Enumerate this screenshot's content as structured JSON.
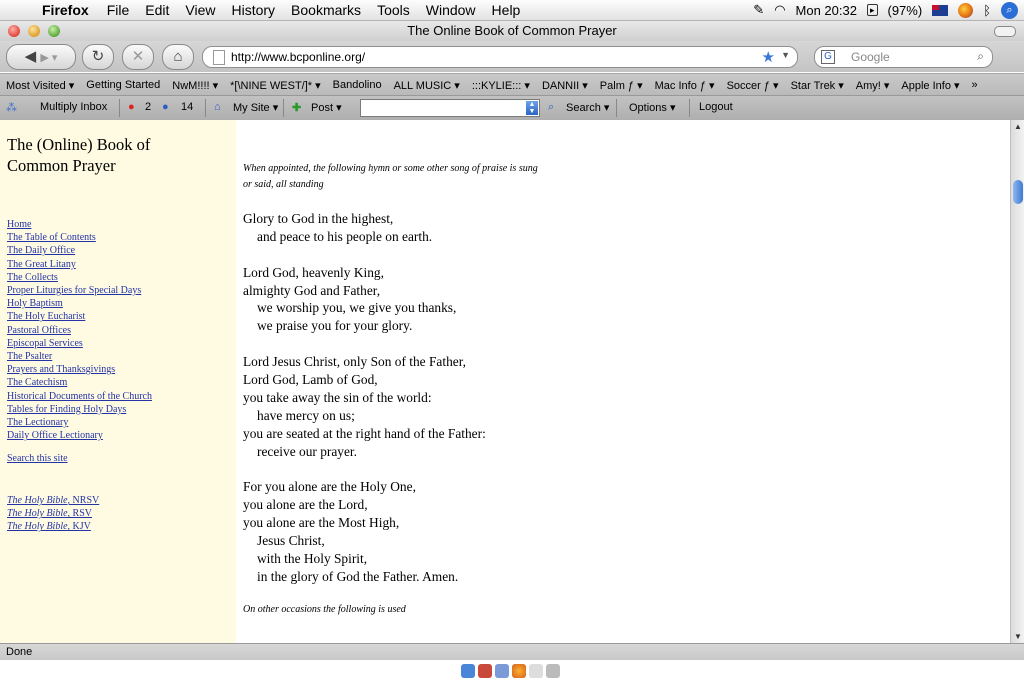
{
  "menubar": {
    "app_name": "Firefox",
    "items": [
      "File",
      "Edit",
      "View",
      "History",
      "Bookmarks",
      "Tools",
      "Window",
      "Help"
    ],
    "clock": "Mon 20:32",
    "battery": "(97%)"
  },
  "window": {
    "title": "The Online Book of Common Prayer"
  },
  "navbar": {
    "url": "http://www.bcponline.org/",
    "search_placeholder": "Google"
  },
  "bookmarks": [
    "Most Visited ▾",
    "Getting Started",
    "NwM!!!! ▾",
    "*[\\NINE WEST/]* ▾",
    "Bandolino",
    "ALL MUSIC ▾",
    ":::KYLIE::: ▾",
    "DANNII ▾",
    "Palm ƒ ▾",
    "Mac Info ƒ ▾",
    "Soccer ƒ ▾",
    "Star Trek ▾",
    "Amy! ▾",
    "Apple Info ▾",
    "»"
  ],
  "extbar": {
    "multiply": "Multiply Inbox",
    "messages": "2",
    "contacts": "14",
    "mysite": "My Site ▾",
    "post": "Post ▾",
    "search": "Search ▾",
    "options": "Options ▾",
    "logout": "Logout"
  },
  "sidebar": {
    "title": "The (Online) Book of Common Prayer",
    "links": [
      "Home",
      "The Table of Contents",
      "The Daily Office",
      "The Great Litany",
      "The Collects",
      "Proper Liturgies for Special Days",
      "Holy Baptism",
      "The Holy Eucharist",
      "Pastoral Offices",
      "Episcopal Services",
      "The Psalter",
      "Prayers and Thanksgivings",
      "The Catechism",
      "Historical Documents of the Church",
      "Tables for Finding Holy Days",
      "The Lectionary",
      "Daily Office Lectionary"
    ],
    "search_link": "Search this site",
    "bibles": [
      {
        "name": "The Holy Bible",
        "version": ", NRSV"
      },
      {
        "name": "The Holy Bible",
        "version": ", RSV"
      },
      {
        "name": "The Holy Bible",
        "version": ", KJV"
      }
    ]
  },
  "content": {
    "rubric_1": "When appointed, the following hymn or some other song of praise is sung or said, all standing",
    "hymn_lines": [
      {
        "t": "Glory to God in the highest,",
        "ind": false
      },
      {
        "t": "and peace to his people on earth.",
        "ind": true
      },
      {
        "t": "",
        "ind": false
      },
      {
        "t": "Lord God, heavenly King,",
        "ind": false
      },
      {
        "t": "almighty God and Father,",
        "ind": false
      },
      {
        "t": "we worship you, we give you thanks,",
        "ind": true
      },
      {
        "t": "we praise you for your glory.",
        "ind": true
      },
      {
        "t": "",
        "ind": false
      },
      {
        "t": "Lord Jesus Christ, only Son of the Father,",
        "ind": false
      },
      {
        "t": "Lord God, Lamb of God,",
        "ind": false
      },
      {
        "t": "you take away the sin of the world:",
        "ind": false
      },
      {
        "t": "have mercy on us;",
        "ind": true
      },
      {
        "t": "you are seated at the right hand of the Father:",
        "ind": false
      },
      {
        "t": "receive our prayer.",
        "ind": true
      },
      {
        "t": "",
        "ind": false
      },
      {
        "t": "For you alone are the Holy One,",
        "ind": false
      },
      {
        "t": "you alone are the Lord,",
        "ind": false
      },
      {
        "t": "you alone are the Most High,",
        "ind": false
      },
      {
        "t": "Jesus Christ,",
        "ind": true
      },
      {
        "t": "with the Holy Spirit,",
        "ind": true
      },
      {
        "t": "in the glory of God the Father. Amen.",
        "ind": true
      }
    ],
    "rubric_2": "On other occasions the following is used"
  },
  "status": {
    "text": "Done"
  }
}
